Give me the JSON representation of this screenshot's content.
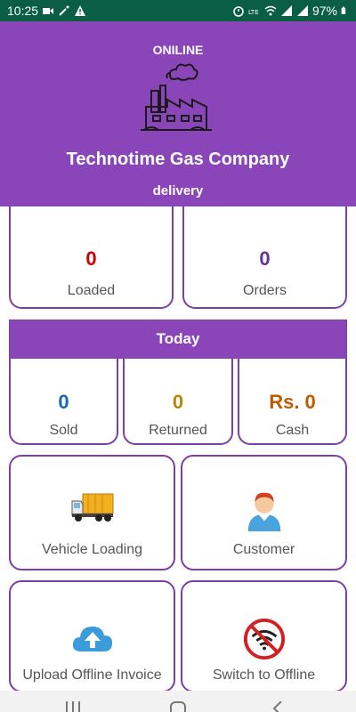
{
  "status_bar": {
    "time": "10:25",
    "battery": "97%",
    "icons": [
      "camera-icon",
      "magic-wand-icon",
      "warning-icon",
      "alarm-icon",
      "volte-icon",
      "wifi-icon",
      "signal-icon",
      "signal-icon",
      "battery-icon"
    ],
    "background": "#0b5e46"
  },
  "header": {
    "status": "ONILINE",
    "company_name": "Technotime Gas Company",
    "role": "delivery",
    "icon": "factory-icon",
    "background": "#8a46b9"
  },
  "summary": {
    "loaded": {
      "value": "0",
      "label": "Loaded",
      "color": "#cc0000"
    },
    "orders": {
      "value": "0",
      "label": "Orders",
      "color": "#6a2f96"
    }
  },
  "today": {
    "title": "Today",
    "sold": {
      "value": "0",
      "label": "Sold",
      "color": "#1565c0"
    },
    "returned": {
      "value": "0",
      "label": "Returned",
      "color": "#b8860b"
    },
    "cash": {
      "value": "Rs. 0",
      "label": "Cash",
      "color": "#c25a00"
    }
  },
  "menu": {
    "vehicle_loading": {
      "label": "Vehicle Loading",
      "icon": "truck-icon"
    },
    "customer": {
      "label": "Customer",
      "icon": "person-icon"
    },
    "upload_offline_invoice": {
      "label": "Upload Offline Invoice",
      "icon": "cloud-upload-icon"
    },
    "switch_to_offline": {
      "label": "Switch to Offline",
      "icon": "no-wifi-icon"
    }
  },
  "nav": {
    "icons": [
      "recents-icon",
      "home-icon",
      "back-icon"
    ]
  }
}
